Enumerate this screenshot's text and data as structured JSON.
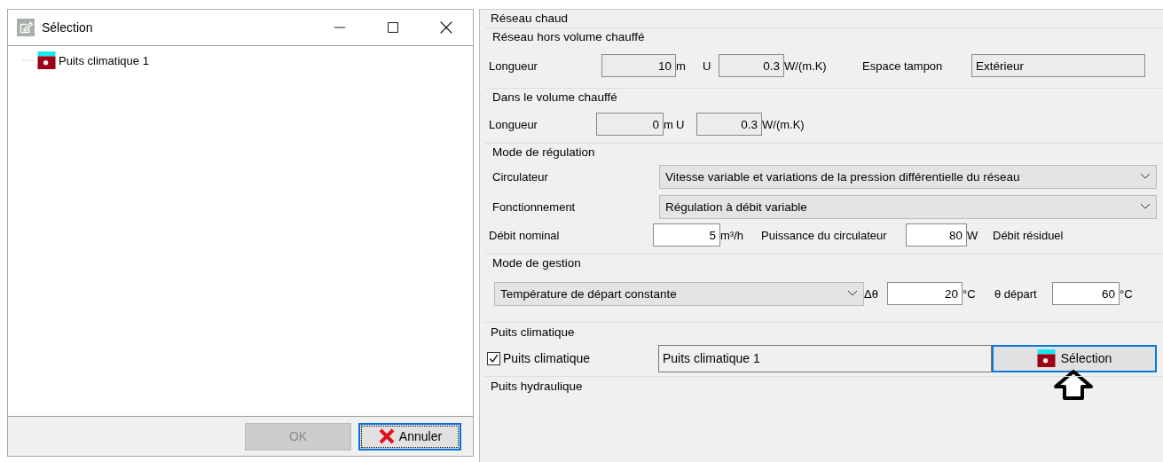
{
  "dialog": {
    "title": "Sélection",
    "tree": [
      {
        "label": "Puits climatique 1"
      }
    ],
    "buttons": [
      {
        "label": "OK",
        "disabled": true,
        "kind": "plain"
      },
      {
        "label": "Annuler",
        "disabled": false,
        "kind": "cancel"
      }
    ]
  },
  "network": {
    "title": "Réseau chaud",
    "groups": [
      {
        "title": "Réseau hors volume chauffé",
        "rows": [
          [
            {
              "kind": "label",
              "text": "Longueur"
            },
            {
              "kind": "field",
              "value": "10",
              "editable": false
            },
            {
              "kind": "label",
              "text": "m"
            },
            {
              "kind": "label",
              "text": "U"
            },
            {
              "kind": "field",
              "value": "0.3",
              "editable": false
            },
            {
              "kind": "label",
              "text": "W/(m.K)"
            },
            {
              "kind": "label",
              "text": "Espace tampon"
            },
            {
              "kind": "textbox",
              "value": "Extérieur",
              "editable": false
            }
          ]
        ]
      },
      {
        "title": "Dans le volume chauffé",
        "rows": [
          [
            {
              "kind": "label",
              "text": "Longueur"
            },
            {
              "kind": "field",
              "value": "0",
              "editable": false
            },
            {
              "kind": "label",
              "text": "m"
            },
            {
              "kind": "label",
              "text": "U"
            },
            {
              "kind": "field",
              "value": "0.3",
              "editable": false
            },
            {
              "kind": "label",
              "text": "W/(m.K)"
            }
          ]
        ]
      },
      {
        "title": "Mode de régulation",
        "rows": [
          [
            {
              "kind": "label",
              "text": "Circulateur"
            },
            {
              "kind": "select",
              "value": "Vitesse variable et variations de la pression différentielle du réseau"
            }
          ],
          [
            {
              "kind": "label",
              "text": "Fonctionnement"
            },
            {
              "kind": "select",
              "value": "Régulation à débit variable"
            }
          ],
          [
            {
              "kind": "label",
              "text": "Débit nominal"
            },
            {
              "kind": "field",
              "value": "5",
              "editable": true
            },
            {
              "kind": "label",
              "text": "m³/h"
            },
            {
              "kind": "label",
              "text": "Puissance du circulateur"
            },
            {
              "kind": "field",
              "value": "80",
              "editable": true
            },
            {
              "kind": "label",
              "text": "W"
            },
            {
              "kind": "label",
              "text": "Débit résiduel"
            }
          ]
        ]
      },
      {
        "title": "Mode de gestion",
        "rows": [
          [
            {
              "kind": "select",
              "value": "Température de départ constante"
            },
            {
              "kind": "label",
              "text": "Δθ"
            },
            {
              "kind": "field",
              "value": "20",
              "editable": true
            },
            {
              "kind": "label",
              "text": "°C"
            },
            {
              "kind": "label",
              "text": "θ départ"
            },
            {
              "kind": "field",
              "value": "60",
              "editable": true
            },
            {
              "kind": "label",
              "text": "°C"
            }
          ]
        ]
      }
    ]
  },
  "wells": [
    {
      "title": "Puits climatique",
      "rows": [
        [
          {
            "kind": "checkbox",
            "label": "Puits climatique",
            "checked": true
          },
          {
            "kind": "textbox",
            "value": "Puits climatique 1",
            "editable": true
          },
          {
            "kind": "button",
            "label": "Sélection"
          }
        ]
      ]
    },
    {
      "title": "Puits hydraulique"
    }
  ]
}
